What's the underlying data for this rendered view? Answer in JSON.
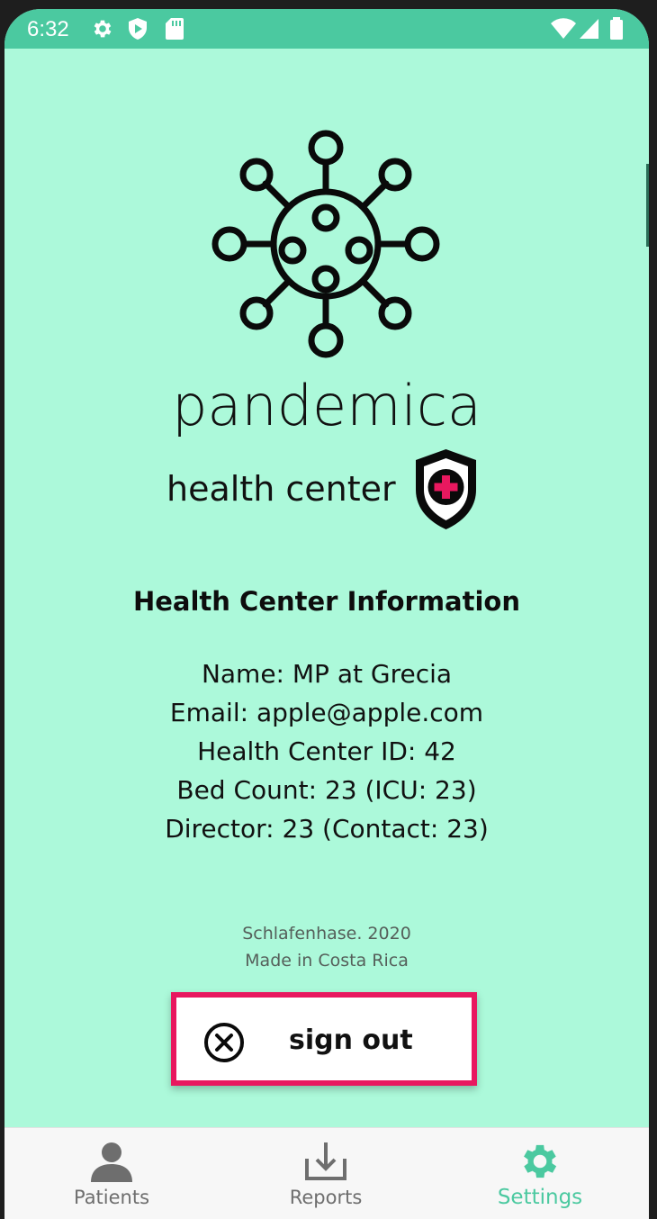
{
  "status_bar": {
    "time": "6:32",
    "left_icons": [
      "settings-gear-icon",
      "shield-play-icon",
      "sd-card-icon"
    ],
    "right_icons": [
      "wifi-icon",
      "cell-signal-icon",
      "battery-icon"
    ]
  },
  "brand": {
    "logo_icon": "virus-icon",
    "title": "pandemica",
    "subtitle": "health center",
    "badge_icon": "shield-cross-icon"
  },
  "info": {
    "heading": "Health Center Information",
    "lines": [
      "Name: MP at Grecia",
      "Email: apple@apple.com",
      "Health Center ID: 42",
      "Bed Count: 23 (ICU: 23)",
      "Director: 23 (Contact: 23)"
    ]
  },
  "credits": {
    "line1": "Schlafenhase. 2020",
    "line2": "Made in Costa Rica"
  },
  "signout": {
    "label": "sign out",
    "icon": "close-circle-icon"
  },
  "bottom_nav": {
    "items": [
      {
        "label": "Patients",
        "icon": "person-icon",
        "active": false
      },
      {
        "label": "Reports",
        "icon": "download-tray-icon",
        "active": false
      },
      {
        "label": "Settings",
        "icon": "gear-icon",
        "active": true
      }
    ]
  },
  "colors": {
    "background": "#acf9da",
    "status_bar": "#4bc9a0",
    "accent": "#4bc9a0",
    "signout_border": "#e8185f",
    "cross_red": "#e8185f"
  }
}
